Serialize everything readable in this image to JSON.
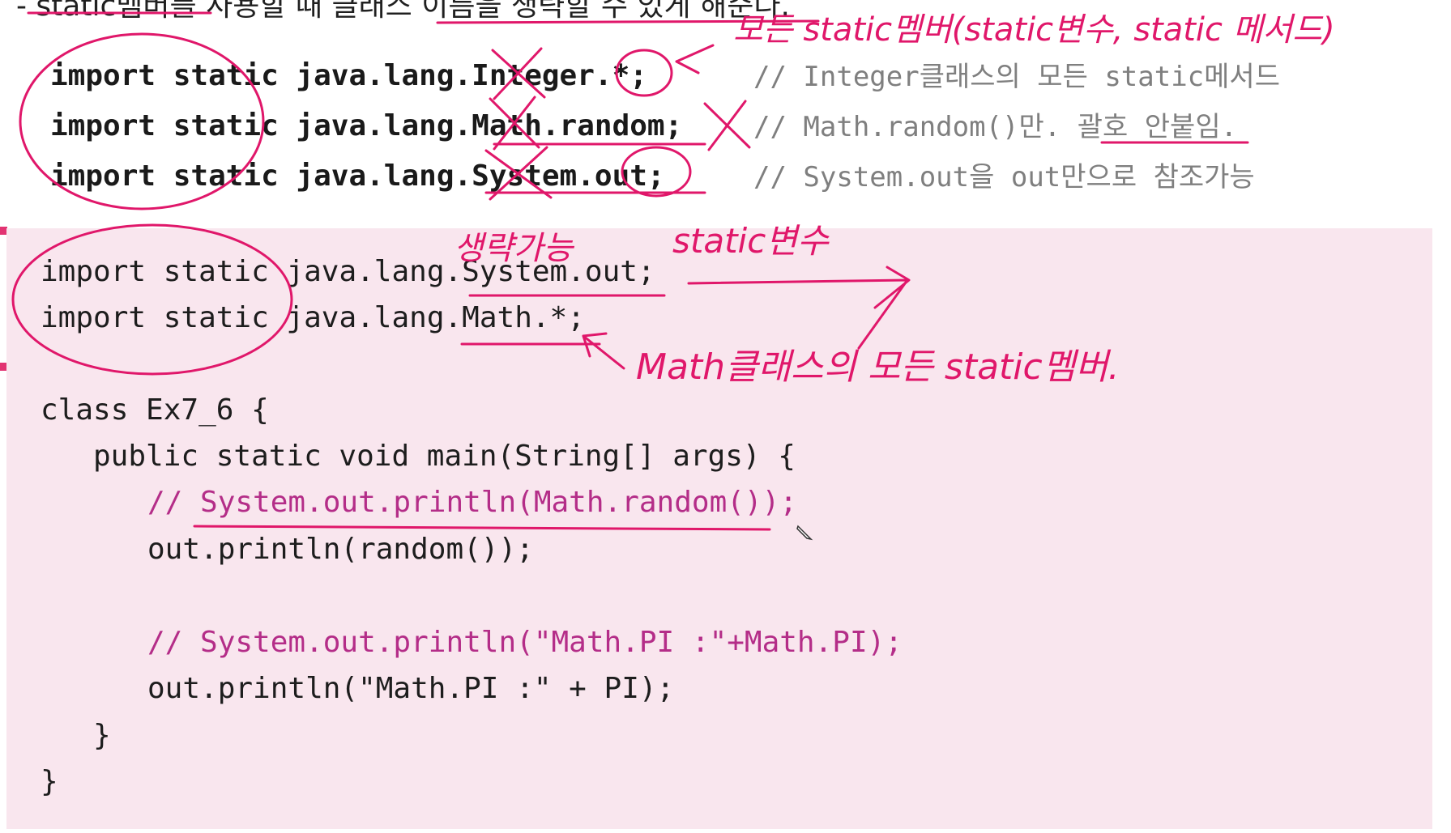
{
  "heading": {
    "text": "- static멤버를 사용할 때 클래스 이름을 생략할 수 있게 해준다."
  },
  "top_examples": [
    {
      "code": "import static java.lang.Integer.*;",
      "comment": "// Integer클래스의 모든 static메서드"
    },
    {
      "code": "import static java.lang.Math.random;",
      "comment": "// Math.random()만. 괄호 안붙임."
    },
    {
      "code": "import static java.lang.System.out;",
      "comment": "// System.out을 out만으로 참조가능"
    }
  ],
  "code_box": {
    "lines": [
      {
        "text": "import static java.lang.System.out;",
        "indent": 0,
        "kind": "code"
      },
      {
        "text": "import static java.lang.Math.*;",
        "indent": 0,
        "kind": "code"
      },
      {
        "text": "class Ex7_6 {",
        "indent": 0,
        "kind": "code"
      },
      {
        "text": "public static void main(String[] args) {",
        "indent": 1,
        "kind": "code"
      },
      {
        "text": "// System.out.println(Math.random());",
        "indent": 2,
        "kind": "comment"
      },
      {
        "text": "out.println(random());",
        "indent": 2,
        "kind": "code"
      },
      {
        "text": "// System.out.println(\"Math.PI :\"+Math.PI);",
        "indent": 2,
        "kind": "comment"
      },
      {
        "text": "out.println(\"Math.PI :\" + PI);",
        "indent": 2,
        "kind": "code"
      },
      {
        "text": "}",
        "indent": 1,
        "kind": "code"
      },
      {
        "text": "}",
        "indent": 0,
        "kind": "code"
      }
    ]
  },
  "annotations": {
    "all_static_members": "모든 static멤버(static변수, static 메서드)",
    "omittable": "생략가능",
    "static_variable": "static변수",
    "math_all_static": "Math클래스의 모든 static멤버."
  },
  "colors": {
    "ink": "#e0176a",
    "box_background": "#f9e6ee",
    "comment": "#b42d88",
    "gray_comment": "#7f7f7f"
  },
  "icons": {
    "cursor": "pen-cursor-icon"
  }
}
